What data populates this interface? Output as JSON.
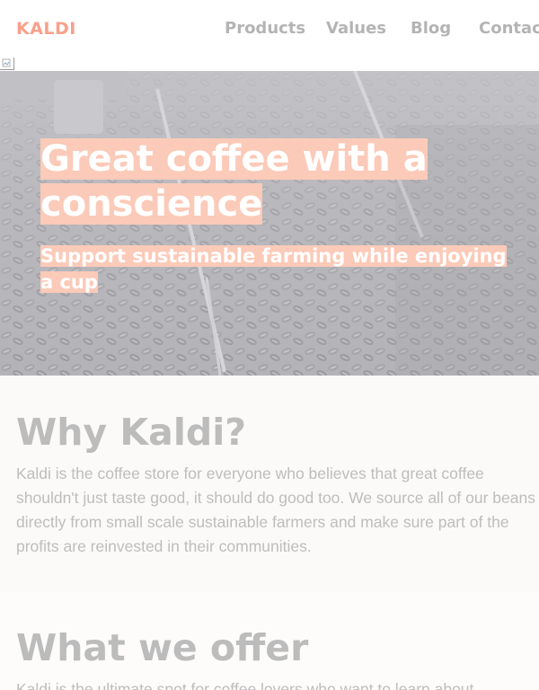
{
  "header": {
    "logo": "KALDI",
    "nav": [
      {
        "label": "Products"
      },
      {
        "label": "Values"
      },
      {
        "label": "Blog"
      },
      {
        "label": "Contact"
      }
    ]
  },
  "hero": {
    "title": "Great coffee with a conscience",
    "subtitle": "Support sustainable farming while enjoying a cup"
  },
  "why": {
    "heading": "Why Kaldi?",
    "text": "Kaldi is the coffee store for everyone who believes that great coffee shouldn't just taste good, it should do good too. We source all of our beans directly from small scale sustainable farmers and make sure part of the profits are reinvested in their communities."
  },
  "offer": {
    "heading": "What we offer",
    "text": "Kaldi is the ultimate spot for coffee lovers who want to learn about"
  },
  "colors": {
    "brand": "#f9a08b",
    "highlight": "#fbcab8",
    "nav_text": "#b4b4b4",
    "section_text": "#bdbdbd"
  },
  "icons": {
    "broken_image": "broken-image-icon"
  }
}
